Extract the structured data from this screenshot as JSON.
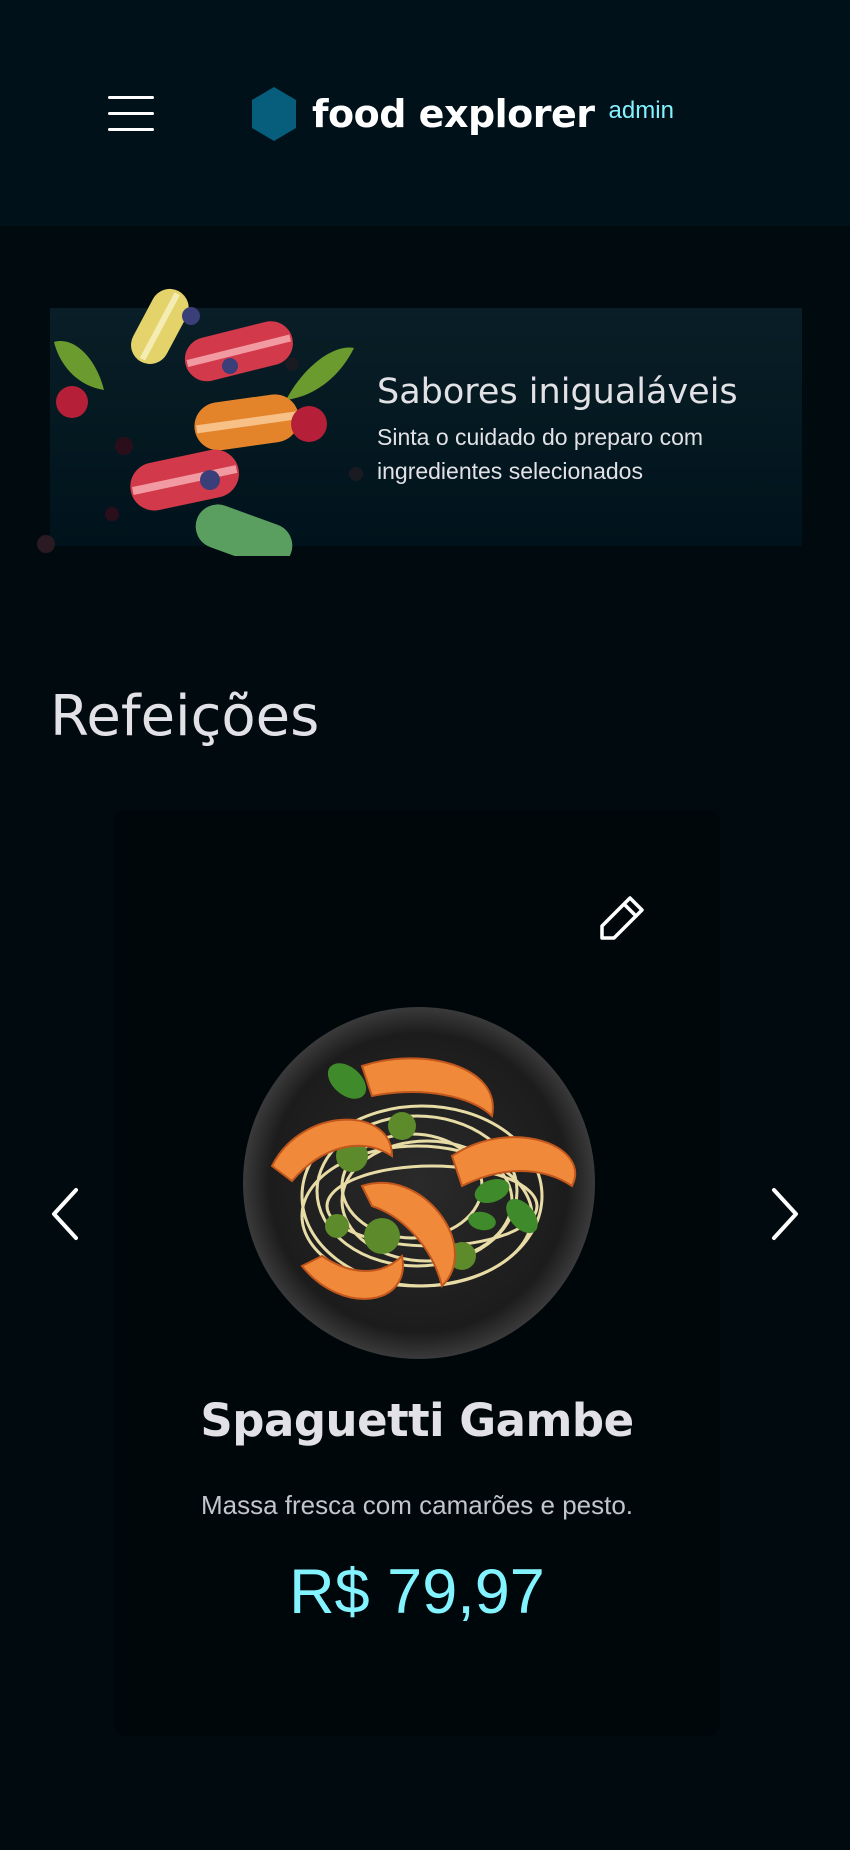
{
  "header": {
    "menu_icon": "hamburger-menu-icon",
    "logo_icon": "hexagon-logo-icon",
    "brand": "food explorer",
    "badge": "admin",
    "colors": {
      "logo": "#065e7c",
      "badge": "#82f3ff"
    }
  },
  "banner": {
    "title": "Sabores inigualáveis",
    "subtitle": "Sinta o cuidado do preparo com ingredientes selecionados",
    "image": "macarons-and-berries-illustration"
  },
  "section": {
    "title": "Refeições"
  },
  "carousel": {
    "prev_icon": "chevron-left-icon",
    "next_icon": "chevron-right-icon",
    "items": [
      {
        "name": "Spaguetti Gambe",
        "description": "Massa fresca com camarões e pesto.",
        "price": "R$ 79,97",
        "edit_icon": "pencil-edit-icon",
        "image": "spaghetti-shrimp-pesto-plate"
      }
    ]
  },
  "colors": {
    "background": "#000a0f",
    "header": "#00111a",
    "card": "#00070a",
    "text": "#e1e1e6",
    "price": "#82f3ff"
  }
}
